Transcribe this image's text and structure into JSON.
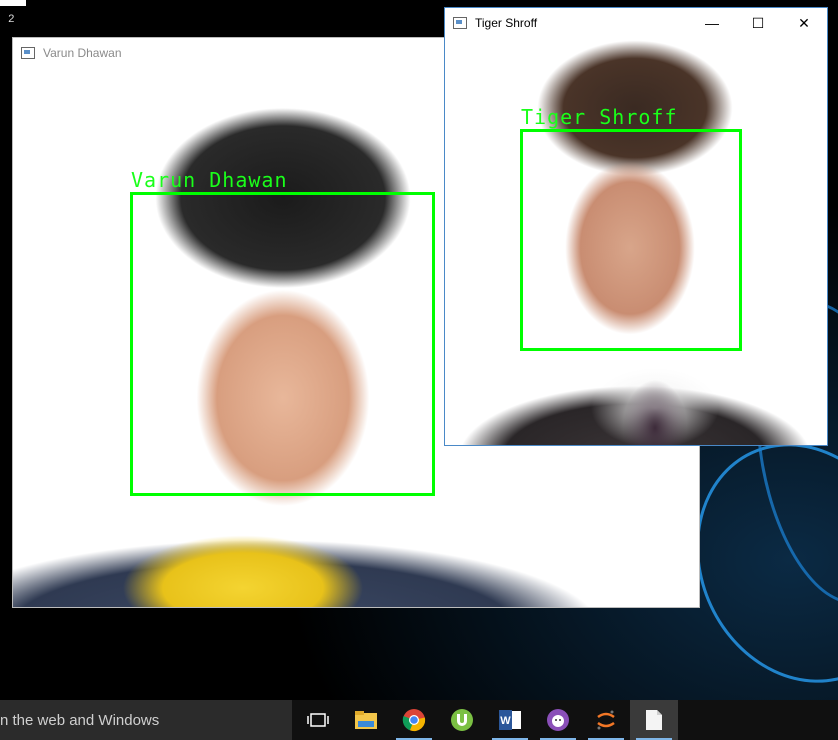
{
  "desktop": {
    "console_text": "2"
  },
  "windows": {
    "varun": {
      "title": "Varun Dhawan",
      "face_label": "Varun Dhawan"
    },
    "tiger": {
      "title": "Tiger Shroff",
      "face_label": "Tiger Shroff",
      "controls": {
        "minimize": "—",
        "maximize": "☐",
        "close": "✕"
      }
    }
  },
  "colors": {
    "detection_box": "#00ff00",
    "label_text": "#1aff1a",
    "taskbar": "#101010",
    "accent_underline": "#7fb6e8"
  },
  "taskbar": {
    "search_text": "n the web and Windows",
    "items": [
      {
        "icon": "task-view-icon"
      },
      {
        "icon": "file-explorer-icon"
      },
      {
        "icon": "chrome-icon"
      },
      {
        "icon": "utorrent-icon"
      },
      {
        "icon": "word-icon"
      },
      {
        "icon": "anaconda-icon"
      },
      {
        "icon": "jupyter-icon"
      },
      {
        "icon": "blank-document-icon"
      }
    ]
  }
}
